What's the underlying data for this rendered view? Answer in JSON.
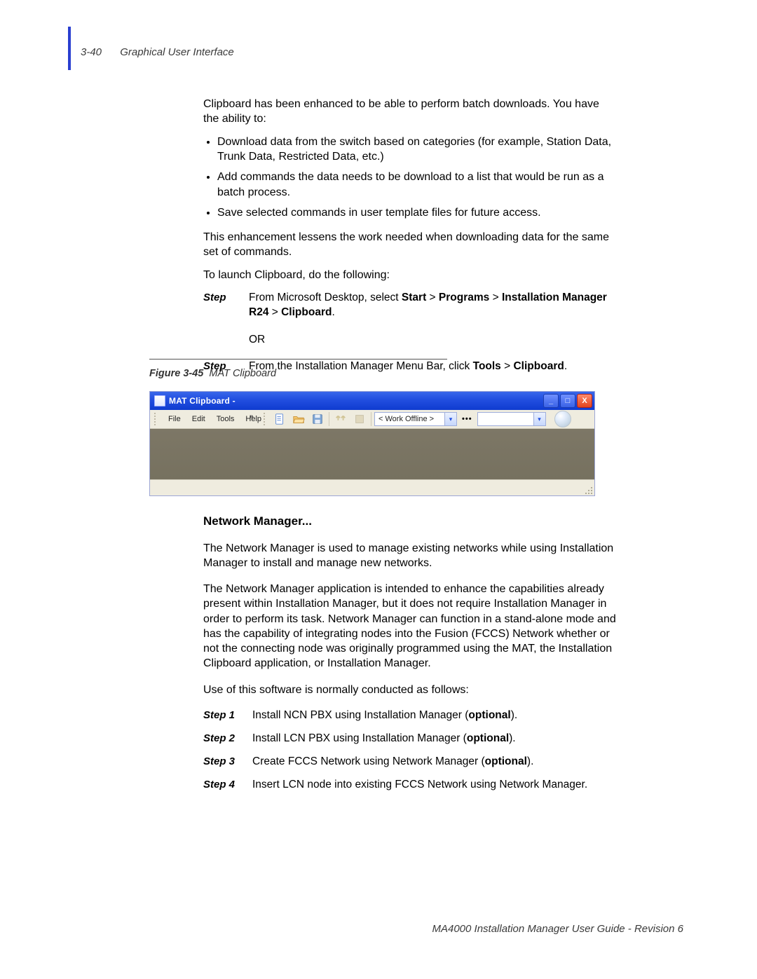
{
  "header": {
    "pageNumber": "3-40",
    "chapter": "Graphical User Interface"
  },
  "intro": {
    "p1": "Clipboard has been enhanced to be able to perform batch downloads. You have the ability to:",
    "bullets": [
      "Download data from the switch based on categories (for example, Station Data, Trunk Data, Restricted Data, etc.)",
      "Add commands the data needs to be download to a list that would be run as a batch process.",
      "Save selected commands in user template files for future access."
    ],
    "p2": "This enhancement lessens the work needed when downloading data for the same set of commands.",
    "p3": "To launch Clipboard, do the following:"
  },
  "launchSteps": {
    "stepLabel": "Step",
    "step1_parts": [
      "From Microsoft Desktop, select ",
      "Start",
      " > ",
      "Programs",
      " > ",
      "Installation Manager R24",
      " > ",
      "Clipboard",
      "."
    ],
    "or": "OR",
    "step2_parts": [
      "From the Installation Manager Menu Bar, click ",
      "Tools",
      " > ",
      "Clipboard",
      "."
    ]
  },
  "figure": {
    "num": "Figure 3-45",
    "title": "MAT Clipboard"
  },
  "shot": {
    "title": "MAT Clipboard -",
    "winButtons": {
      "min": "_",
      "max": "□",
      "close": "X"
    },
    "menu": [
      "File",
      "Edit",
      "Tools",
      "Help"
    ],
    "chev": "»",
    "combo1": "< Work Offline >",
    "combo2": "",
    "dots": "•••"
  },
  "nm": {
    "heading": "Network Manager...",
    "p1": "The Network Manager is used to manage existing networks while using Installation Manager to install and manage new networks.",
    "p2": "The Network Manager application is intended to enhance the capabilities already present within Installation Manager, but it does not require Installation Manager in order to perform its task. Network Manager can function in a stand-alone mode and has the capability of integrating nodes into the Fusion (FCCS) Network whether or not the connecting node was originally programmed using the MAT, the Installation Clipboard application, or Installation Manager.",
    "p3": "Use of this software is normally conducted as follows:",
    "steps": [
      {
        "label": "Step 1",
        "pre": "Install NCN PBX using Installation Manager (",
        "bold": "optional",
        "post": ")."
      },
      {
        "label": "Step 2",
        "pre": "Install LCN PBX using Installation Manager (",
        "bold": "optional",
        "post": ")."
      },
      {
        "label": "Step 3",
        "pre": "Create FCCS Network using Network Manager (",
        "bold": "optional",
        "post": ")."
      },
      {
        "label": "Step 4",
        "pre": "Insert LCN node into existing FCCS Network using Network Manager.",
        "bold": "",
        "post": ""
      }
    ]
  },
  "footer": "MA4000 Installation Manager User Guide - Revision 6"
}
